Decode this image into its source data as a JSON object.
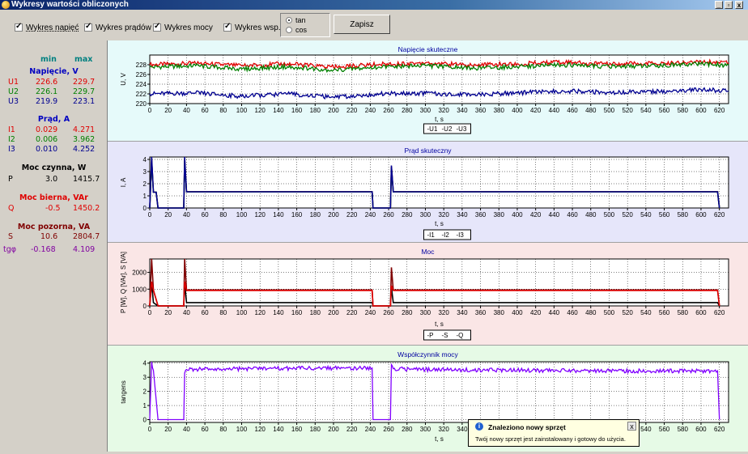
{
  "window": {
    "title": "Wykresy wartości obliczonych",
    "controls": [
      "_",
      "▫",
      "x"
    ]
  },
  "toolbar": {
    "checkboxes": [
      {
        "label": "Wykres napięć",
        "checked": true
      },
      {
        "label": "Wykres prądów",
        "checked": true
      },
      {
        "label": "Wykres mocy",
        "checked": true
      },
      {
        "label": "Wykres wsp.",
        "checked": true
      }
    ],
    "radios": [
      {
        "label": "tan",
        "selected": true
      },
      {
        "label": "cos",
        "selected": false
      }
    ],
    "save_label": "Zapisz"
  },
  "stats": {
    "min_label": "min",
    "max_label": "max",
    "voltage": {
      "heading": "Napięcie, V",
      "rows": [
        {
          "name": "U1",
          "min": "226.6",
          "max": "229.7",
          "color": "#e00000"
        },
        {
          "name": "U2",
          "min": "226.1",
          "max": "229.7",
          "color": "#008000"
        },
        {
          "name": "U3",
          "min": "219.9",
          "max": "223.1",
          "color": "#000090"
        }
      ]
    },
    "current": {
      "heading": "Prąd, A",
      "rows": [
        {
          "name": "I1",
          "min": "0.029",
          "max": "4.271",
          "color": "#e00000"
        },
        {
          "name": "I2",
          "min": "0.006",
          "max": "3.962",
          "color": "#008000"
        },
        {
          "name": "I3",
          "min": "0.010",
          "max": "4.252",
          "color": "#000090"
        }
      ]
    },
    "active": {
      "heading": "Moc czynna, W",
      "name": "P",
      "min": "3.0",
      "max": "1415.7",
      "color": "#000000"
    },
    "reactive": {
      "heading": "Moc bierna, VAr",
      "name": "Q",
      "min": "-0.5",
      "max": "1450.2",
      "color": "#e00000"
    },
    "apparent": {
      "heading": "Moc pozorna, VA",
      "name": "S",
      "min": "10.6",
      "max": "2804.7",
      "color": "#800000"
    },
    "tg": {
      "name": "tgφ",
      "min": "-0.168",
      "max": "4.109",
      "color": "#8000a0"
    }
  },
  "chart_data": [
    {
      "type": "line",
      "title": "Napięcie skuteczne",
      "xlabel": "t, s",
      "ylabel": "U, V",
      "xlim": [
        0,
        630
      ],
      "ylim": [
        220,
        230
      ],
      "yticks": [
        220,
        222,
        224,
        226,
        228
      ],
      "series": [
        {
          "name": "U1",
          "color": "#e00000",
          "x": [
            0,
            50,
            100,
            150,
            200,
            250,
            300,
            350,
            400,
            450,
            500,
            550,
            600,
            630
          ],
          "y": [
            228,
            228.3,
            227.8,
            228.2,
            227.5,
            228.1,
            228.4,
            227.9,
            228.2,
            228.5,
            228.1,
            228.3,
            228.6,
            228.4
          ]
        },
        {
          "name": "U2",
          "color": "#008000",
          "x": [
            0,
            50,
            100,
            150,
            200,
            250,
            300,
            350,
            400,
            450,
            500,
            550,
            600,
            630
          ],
          "y": [
            227.5,
            227.8,
            227.1,
            227.6,
            226.9,
            227.5,
            227.8,
            227.3,
            227.6,
            228,
            227.6,
            227.8,
            228.2,
            227.9
          ]
        },
        {
          "name": "U3",
          "color": "#000090",
          "x": [
            0,
            50,
            100,
            150,
            200,
            250,
            300,
            350,
            400,
            450,
            500,
            550,
            600,
            630
          ],
          "y": [
            222,
            222.2,
            221.5,
            222,
            221.3,
            222,
            222.1,
            221.8,
            222.2,
            222.6,
            222.3,
            222.5,
            222.9,
            222.6
          ]
        }
      ]
    },
    {
      "type": "line",
      "title": "Prąd skuteczny",
      "xlabel": "t, s",
      "ylabel": "I, A",
      "xlim": [
        0,
        630
      ],
      "ylim": [
        0,
        4.2
      ],
      "yticks": [
        0,
        1,
        2,
        3,
        4
      ],
      "series": [
        {
          "name": "I1",
          "color": "#e00000",
          "x": [
            0,
            2,
            4,
            7,
            9,
            12,
            37,
            38,
            40,
            242,
            243,
            262,
            263,
            265,
            618,
            620
          ],
          "y": [
            0,
            4,
            1.3,
            1.3,
            0,
            0,
            0,
            4,
            1.35,
            1.35,
            0,
            0,
            3.4,
            1.35,
            1.35,
            0
          ]
        },
        {
          "name": "I2",
          "color": "#008000",
          "x": [
            0,
            2,
            4,
            7,
            9,
            12,
            37,
            38,
            40,
            242,
            243,
            262,
            263,
            265,
            618,
            620
          ],
          "y": [
            0,
            3.9,
            1.3,
            1.3,
            0,
            0,
            0,
            3.9,
            1.33,
            1.33,
            0,
            0,
            3.3,
            1.33,
            1.33,
            0
          ]
        },
        {
          "name": "I3",
          "color": "#000090",
          "x": [
            0,
            2,
            4,
            7,
            9,
            12,
            37,
            38,
            40,
            242,
            243,
            262,
            263,
            265,
            618,
            620
          ],
          "y": [
            0,
            4.2,
            1.3,
            1.3,
            0,
            0,
            0,
            4.2,
            1.33,
            1.33,
            0,
            0,
            3.5,
            1.33,
            1.33,
            0
          ]
        }
      ]
    },
    {
      "type": "line",
      "title": "Moc",
      "xlabel": "t, s",
      "ylabel": "P [W], Q [VAr], S [VA]",
      "xlim": [
        0,
        630
      ],
      "ylim": [
        0,
        2800
      ],
      "yticks": [
        0,
        1000,
        2000
      ],
      "series": [
        {
          "name": "P",
          "color": "#000000",
          "x": [
            0,
            2,
            4,
            9,
            12,
            37,
            38,
            40,
            242,
            243,
            262,
            263,
            265,
            618,
            620
          ],
          "y": [
            0,
            1400,
            200,
            0,
            0,
            0,
            1400,
            200,
            200,
            0,
            0,
            1100,
            200,
            200,
            0
          ]
        },
        {
          "name": "S",
          "color": "#800000",
          "x": [
            0,
            2,
            4,
            9,
            12,
            37,
            38,
            40,
            242,
            243,
            262,
            263,
            265,
            618,
            620
          ],
          "y": [
            0,
            2800,
            950,
            0,
            0,
            0,
            2800,
            950,
            950,
            0,
            0,
            2300,
            950,
            950,
            0
          ]
        },
        {
          "name": "Q",
          "color": "#e00000",
          "x": [
            0,
            2,
            4,
            9,
            12,
            37,
            38,
            40,
            242,
            243,
            262,
            263,
            265,
            618,
            620
          ],
          "y": [
            0,
            1450,
            920,
            0,
            0,
            0,
            1450,
            920,
            920,
            0,
            0,
            1200,
            920,
            920,
            0
          ]
        }
      ]
    },
    {
      "type": "line",
      "title": "Współczynnik mocy",
      "xlabel": "t, s",
      "ylabel": "tangens",
      "xlim": [
        0,
        630
      ],
      "ylim": [
        -0.2,
        4.1
      ],
      "yticks": [
        0,
        1,
        2,
        3,
        4
      ],
      "series": [
        {
          "name": "tgφ",
          "color": "#8000ff",
          "x": [
            0,
            2,
            4,
            9,
            12,
            37,
            38,
            40,
            100,
            200,
            242,
            243,
            262,
            263,
            265,
            300,
            400,
            500,
            600,
            618,
            620
          ],
          "y": [
            0,
            4.1,
            3.5,
            0,
            0,
            0,
            3.3,
            3.55,
            3.6,
            3.65,
            3.65,
            0,
            0,
            3.9,
            3.6,
            3.55,
            3.5,
            3.45,
            3.45,
            3.45,
            0
          ]
        }
      ]
    }
  ],
  "legends": [
    [
      "U1",
      "U2",
      "U3"
    ],
    [
      "I1",
      "I2",
      "I3"
    ],
    [
      "P",
      "S",
      "Q"
    ]
  ],
  "notification": {
    "title": "Znaleziono nowy sprzęt",
    "body": "Twój nowy sprzęt jest zainstalowany i gotowy do użycia.",
    "close": "x"
  }
}
